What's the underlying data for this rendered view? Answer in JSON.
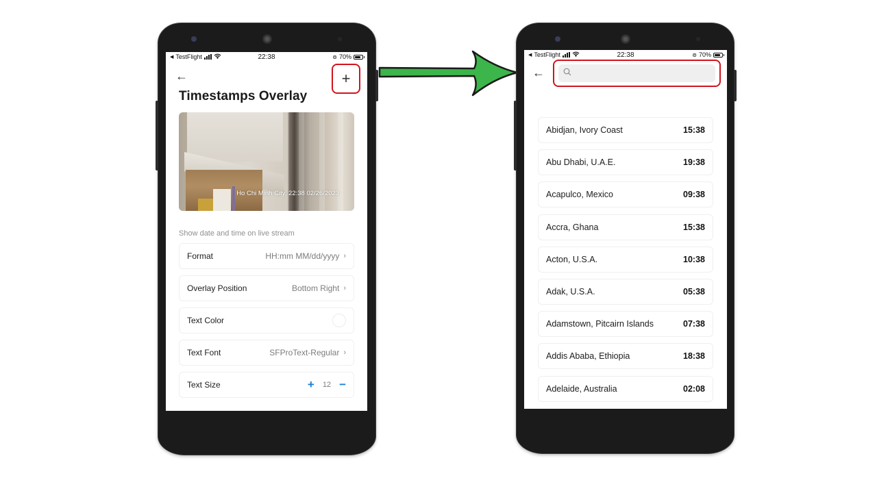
{
  "status_bar": {
    "carrier": "TestFlight",
    "time": "22:38",
    "battery_percent": "70%",
    "battery_level": 0.7
  },
  "left_screen": {
    "back_icon": "arrow-left-icon",
    "add_icon": "plus-icon",
    "add_glyph": "+",
    "title": "Timestamps Overlay",
    "preview_overlay_text": "Ho Chi Minh City, 22:38 02/26/2023",
    "hint": "Show date and time on live stream",
    "settings": [
      {
        "label": "Format",
        "value": "HH:mm MM/dd/yyyy"
      },
      {
        "label": "Overlay Position",
        "value": "Bottom Right"
      },
      {
        "label": "Text Color",
        "color": "#ffffff"
      },
      {
        "label": "Text Font",
        "value": "SFProText-Regular"
      },
      {
        "label": "Text Size",
        "value": "12",
        "increase": "+",
        "decrease": "−"
      }
    ]
  },
  "right_screen": {
    "back_icon": "arrow-left-icon",
    "search_icon": "magnifier-icon",
    "search_placeholder": "",
    "search_value": "",
    "cities": [
      {
        "name": "Abidjan, Ivory Coast",
        "time": "15:38"
      },
      {
        "name": "Abu Dhabi, U.A.E.",
        "time": "19:38"
      },
      {
        "name": "Acapulco, Mexico",
        "time": "09:38"
      },
      {
        "name": "Accra, Ghana",
        "time": "15:38"
      },
      {
        "name": "Acton, U.S.A.",
        "time": "10:38"
      },
      {
        "name": "Adak, U.S.A.",
        "time": "05:38"
      },
      {
        "name": "Adamstown, Pitcairn Islands",
        "time": "07:38"
      },
      {
        "name": "Addis Ababa, Ethiopia",
        "time": "18:38"
      },
      {
        "name": "Adelaide, Australia",
        "time": "02:08"
      }
    ]
  },
  "annotations": {
    "highlight_color": "#d0141c",
    "arrow_color": "#3cb54a"
  },
  "glyphs": {
    "back": "←",
    "chevron": "›"
  }
}
